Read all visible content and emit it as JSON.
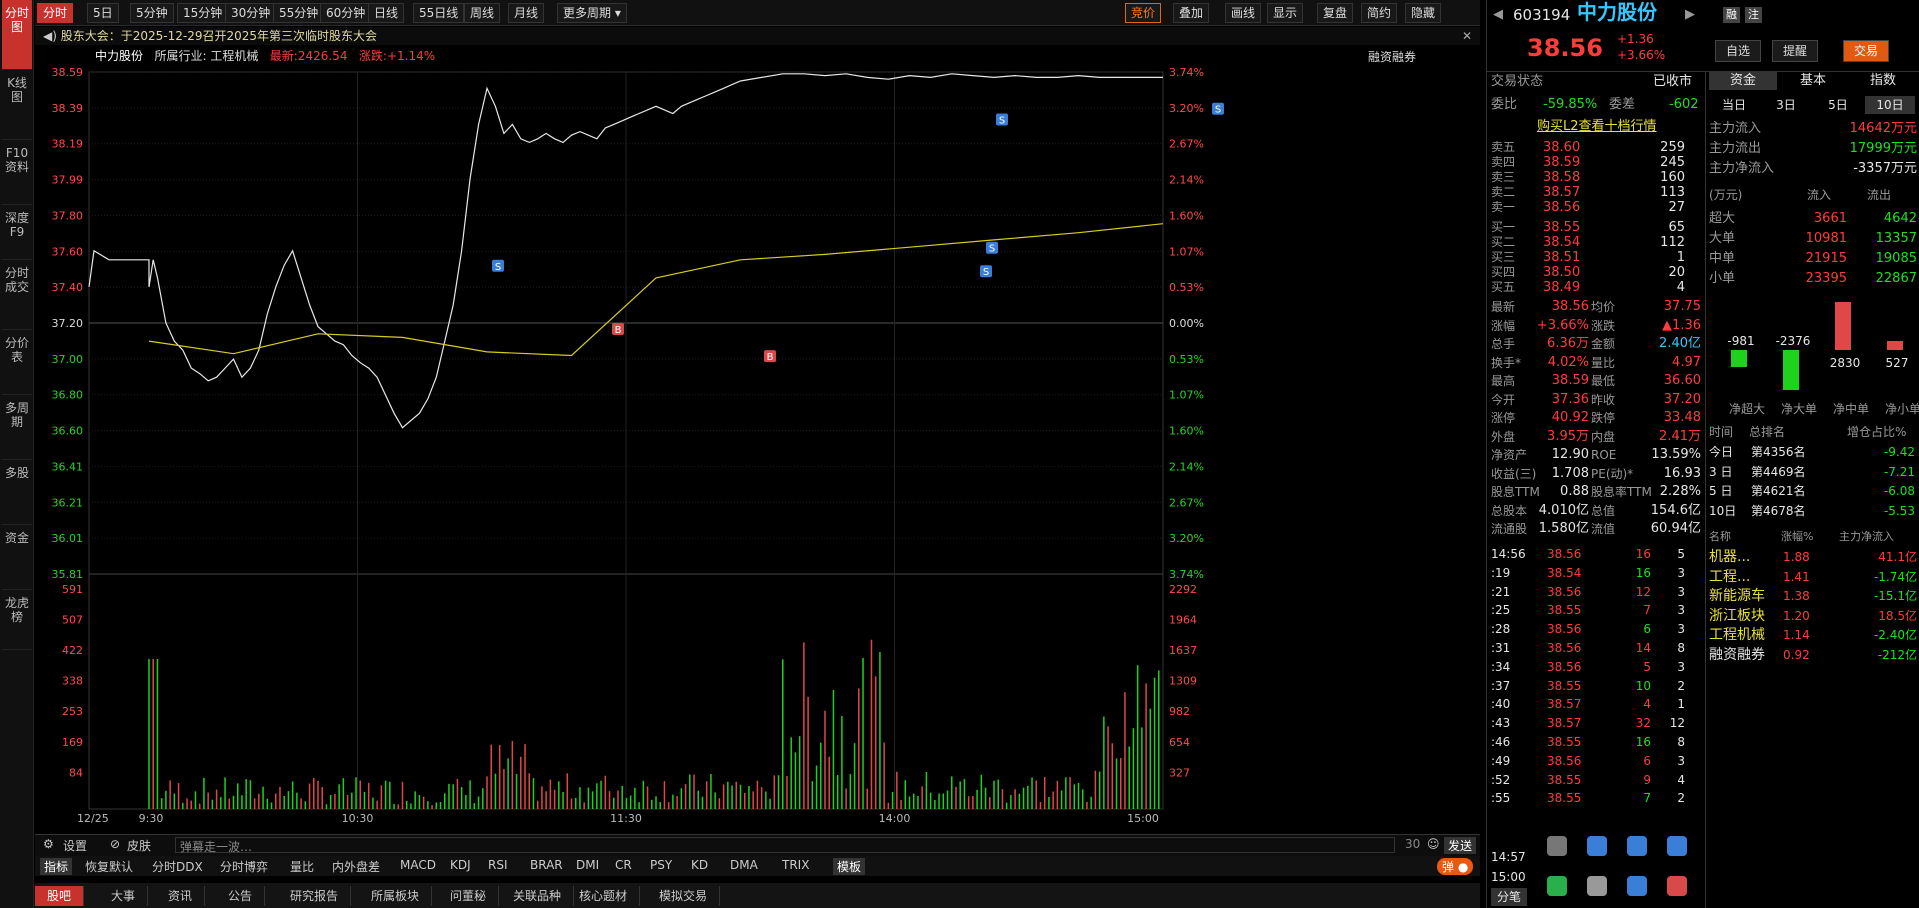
{
  "left_nav": [
    "分时图",
    "K线图",
    "F10资料",
    "深度F9",
    "分时成交",
    "分价表",
    "多周期",
    "多股",
    "资金",
    "龙虎榜"
  ],
  "top_periods": [
    "分时",
    "5日",
    "5分钟",
    "15分钟",
    "30分钟",
    "55分钟",
    "60分钟",
    "日线",
    "55日线",
    "周线",
    "月线",
    "更多周期"
  ],
  "top_right": [
    "竞价",
    "叠加",
    "画线",
    "显示",
    "复盘",
    "简约",
    "隐藏"
  ],
  "notice": "股东大会：于2025-12-29召开2025年第三次临时股东大会",
  "stock_bar": {
    "name": "中力股份",
    "industry": "所属行业: 工程机械",
    "latest": "最新:2426.54",
    "change": "涨跌:+1.14%"
  },
  "rzrq_label": "融资融券",
  "price_axis": [
    "38.59",
    "38.39",
    "38.19",
    "37.99",
    "37.80",
    "37.60",
    "37.40",
    "37.20",
    "37.00",
    "36.80",
    "36.60",
    "36.41",
    "36.21",
    "36.01",
    "35.81"
  ],
  "pct_axis": [
    "3.74%",
    "3.20%",
    "2.67%",
    "2.14%",
    "1.60%",
    "1.07%",
    "0.53%",
    "0.00%",
    "0.53%",
    "1.07%",
    "1.60%",
    "2.14%",
    "2.67%",
    "3.20%",
    "3.74%"
  ],
  "vol_axis_left": [
    "591",
    "507",
    "422",
    "338",
    "253",
    "169",
    "84"
  ],
  "vol_axis_right": [
    "2292",
    "1964",
    "1637",
    "1309",
    "982",
    "654",
    "327"
  ],
  "time_axis": [
    "12/25",
    "9:30",
    "10:30",
    "11:30",
    "14:00",
    "15:00"
  ],
  "chart_data": {
    "type": "line",
    "title": "",
    "xlabel": "",
    "ylabel": "",
    "ylim": [
      35.81,
      38.59
    ],
    "price_x": [
      0,
      1,
      2,
      4,
      6,
      8,
      10,
      12,
      14,
      16,
      18,
      20,
      22,
      24,
      26,
      28,
      30,
      32,
      34,
      36,
      38,
      40,
      42,
      44,
      46,
      48,
      50,
      52,
      54,
      56,
      58,
      60,
      62,
      64,
      66,
      68,
      70,
      72,
      74,
      76,
      78,
      80,
      82,
      84,
      86,
      88,
      90,
      92,
      94,
      96,
      98,
      100,
      102,
      104,
      106,
      108,
      110,
      112,
      114,
      116,
      118,
      120,
      122,
      124,
      126,
      128,
      130,
      132,
      134,
      136,
      138,
      140,
      145,
      150,
      155,
      160,
      165,
      170,
      175,
      180,
      185,
      190,
      195,
      200,
      205,
      210,
      215,
      220,
      225,
      230,
      235,
      240
    ],
    "price": [
      37.4,
      37.55,
      37.45,
      37.2,
      37.1,
      37.05,
      36.95,
      36.92,
      36.88,
      36.9,
      36.95,
      37.0,
      36.9,
      36.95,
      37.05,
      37.25,
      37.4,
      37.52,
      37.6,
      37.45,
      37.3,
      37.18,
      37.14,
      37.1,
      37.08,
      37.02,
      36.98,
      36.95,
      36.9,
      36.8,
      36.7,
      36.62,
      36.66,
      36.7,
      36.78,
      36.9,
      37.1,
      37.3,
      37.6,
      38.0,
      38.3,
      38.5,
      38.4,
      38.25,
      38.3,
      38.22,
      38.2,
      38.22,
      38.25,
      38.22,
      38.2,
      38.24,
      38.26,
      38.24,
      38.22,
      38.28,
      38.3,
      38.32,
      38.34,
      38.36,
      38.38,
      38.4,
      38.38,
      38.36,
      38.4,
      38.42,
      38.44,
      38.46,
      38.48,
      38.5,
      38.52,
      38.54,
      38.56,
      38.58,
      38.58,
      38.57,
      38.58,
      38.56,
      38.55,
      38.57,
      38.56,
      38.58,
      38.57,
      38.56,
      38.57,
      38.56,
      38.56,
      38.57,
      38.56,
      38.56,
      38.56,
      38.56
    ],
    "avg_x": [
      0,
      20,
      40,
      60,
      80,
      100,
      120,
      140,
      160,
      180,
      200,
      220,
      240
    ],
    "avg": [
      37.1,
      37.03,
      37.14,
      37.12,
      37.04,
      37.02,
      37.45,
      37.55,
      37.58,
      37.62,
      37.66,
      37.7,
      37.75
    ]
  },
  "quote": {
    "code": "603194",
    "name": "中力股份",
    "price": "38.56",
    "chg": "+1.36",
    "pct": "+3.66%"
  },
  "quote_buttons": [
    "自选",
    "提醒",
    "交易"
  ],
  "trade_state": {
    "label": "交易状态",
    "value": "已收市"
  },
  "weibi": {
    "l1": "委比",
    "v1": "-59.85%",
    "l2": "委差",
    "v2": "-602"
  },
  "l2_link": "购买L2查看十档行情",
  "asks": [
    [
      "卖五",
      "38.60",
      "259"
    ],
    [
      "卖四",
      "38.59",
      "245"
    ],
    [
      "卖三",
      "38.58",
      "160"
    ],
    [
      "卖二",
      "38.57",
      "113"
    ],
    [
      "卖一",
      "38.56",
      "27"
    ]
  ],
  "bids": [
    [
      "买一",
      "38.55",
      "65"
    ],
    [
      "买二",
      "38.54",
      "112"
    ],
    [
      "买三",
      "38.51",
      "1"
    ],
    [
      "买四",
      "38.50",
      "20"
    ],
    [
      "买五",
      "38.49",
      "4"
    ]
  ],
  "stats": [
    [
      "最新",
      "38.56",
      "均价",
      "37.75"
    ],
    [
      "涨幅",
      "+3.66%",
      "涨跌",
      "▲1.36"
    ],
    [
      "总手",
      "6.36万",
      "金额",
      "2.40亿"
    ],
    [
      "换手*",
      "4.02%",
      "量比",
      "4.97"
    ],
    [
      "最高",
      "38.59",
      "最低",
      "36.60"
    ],
    [
      "今开",
      "37.36",
      "昨收",
      "37.20"
    ],
    [
      "涨停",
      "40.92",
      "跌停",
      "33.48"
    ],
    [
      "外盘",
      "3.95万",
      "内盘",
      "2.41万"
    ],
    [
      "净资产",
      "12.90",
      "ROE",
      "13.59%"
    ],
    [
      "收益(三)",
      "1.708",
      "PE(动)*",
      "16.93"
    ],
    [
      "股息TTM",
      "0.88",
      "股息率TTM",
      "2.28%"
    ],
    [
      "总股本",
      "4.010亿",
      "总值",
      "154.6亿"
    ],
    [
      "流通股",
      "1.580亿",
      "流值",
      "60.94亿"
    ]
  ],
  "ticks": [
    [
      "14:56",
      "38.56",
      "16",
      "5"
    ],
    [
      ":19",
      "38.54",
      "16",
      "3"
    ],
    [
      ":21",
      "38.56",
      "12",
      "3"
    ],
    [
      ":25",
      "38.55",
      "7",
      "3"
    ],
    [
      ":28",
      "38.56",
      "6",
      "3"
    ],
    [
      ":31",
      "38.56",
      "14",
      "8"
    ],
    [
      ":34",
      "38.56",
      "5",
      "3"
    ],
    [
      ":37",
      "38.55",
      "10",
      "2"
    ],
    [
      ":40",
      "38.57",
      "4",
      "1"
    ],
    [
      ":43",
      "38.57",
      "32",
      "12"
    ],
    [
      ":46",
      "38.55",
      "16",
      "8"
    ],
    [
      ":49",
      "38.56",
      "6",
      "3"
    ],
    [
      ":52",
      "38.55",
      "9",
      "4"
    ],
    [
      ":55",
      "38.55",
      "7",
      "2"
    ]
  ],
  "tick_times_bottom": [
    "14:57",
    "15:00"
  ],
  "fund_tabs": [
    "资金",
    "基本",
    "指数"
  ],
  "day_tabs": [
    "当日",
    "3日",
    "5日",
    "10日"
  ],
  "flow": [
    [
      "主力流入",
      "14642万元"
    ],
    [
      "主力流出",
      "17999万元"
    ],
    [
      "主力净流入",
      "-3357万元"
    ]
  ],
  "flow_head": [
    "(万元)",
    "流入",
    "流出"
  ],
  "flow_table": [
    [
      "超大",
      "3661",
      "4642"
    ],
    [
      "大单",
      "10981",
      "13357"
    ],
    [
      "中单",
      "21915",
      "19085"
    ],
    [
      "小单",
      "23395",
      "22867"
    ]
  ],
  "net_bars": {
    "values": [
      -981,
      -2376,
      2830,
      527
    ],
    "labels": [
      "净超大",
      "净大单",
      "净中单",
      "净小单"
    ]
  },
  "rank_head": [
    "时间",
    "总排名",
    "增仓占比%"
  ],
  "rank": [
    [
      "今日",
      "第4356名",
      "-9.42"
    ],
    [
      "3 日",
      "第4469名",
      "-7.21"
    ],
    [
      "5 日",
      "第4621名",
      "-6.08"
    ],
    [
      "10日",
      "第4678名",
      "-5.53"
    ]
  ],
  "sector_head": [
    "名称",
    "涨幅%",
    "主力净流入"
  ],
  "sectors": [
    [
      "机器...",
      "1.88",
      "41.1亿"
    ],
    [
      "工程...",
      "1.41",
      "-1.74亿"
    ],
    [
      "新能源车",
      "1.38",
      "-15.1亿"
    ],
    [
      "浙江板块",
      "1.20",
      "18.5亿"
    ],
    [
      "工程机械",
      "1.14",
      "-2.40亿"
    ],
    [
      "融资融券",
      "0.92",
      "-212亿"
    ]
  ],
  "bottom_tools": {
    "settings": "设置",
    "skin": "皮肤",
    "danmu": "弹幕走一波…",
    "count": "30",
    "send": "发送"
  },
  "indicators": [
    "指标",
    "恢复默认",
    "分时DDX",
    "分时博弈",
    "量比",
    "内外盘差",
    "MACD",
    "KDJ",
    "RSI",
    "BRAR",
    "DMI",
    "CR",
    "PSY",
    "KD",
    "DMA",
    "TRIX",
    "模板"
  ],
  "bottom_tabs": [
    "股吧",
    "大事",
    "资讯",
    "公告",
    "研究报告",
    "所属板块",
    "问董秘",
    "关联品种",
    "核心题材",
    "模拟交易"
  ],
  "fenbi": "分笔"
}
